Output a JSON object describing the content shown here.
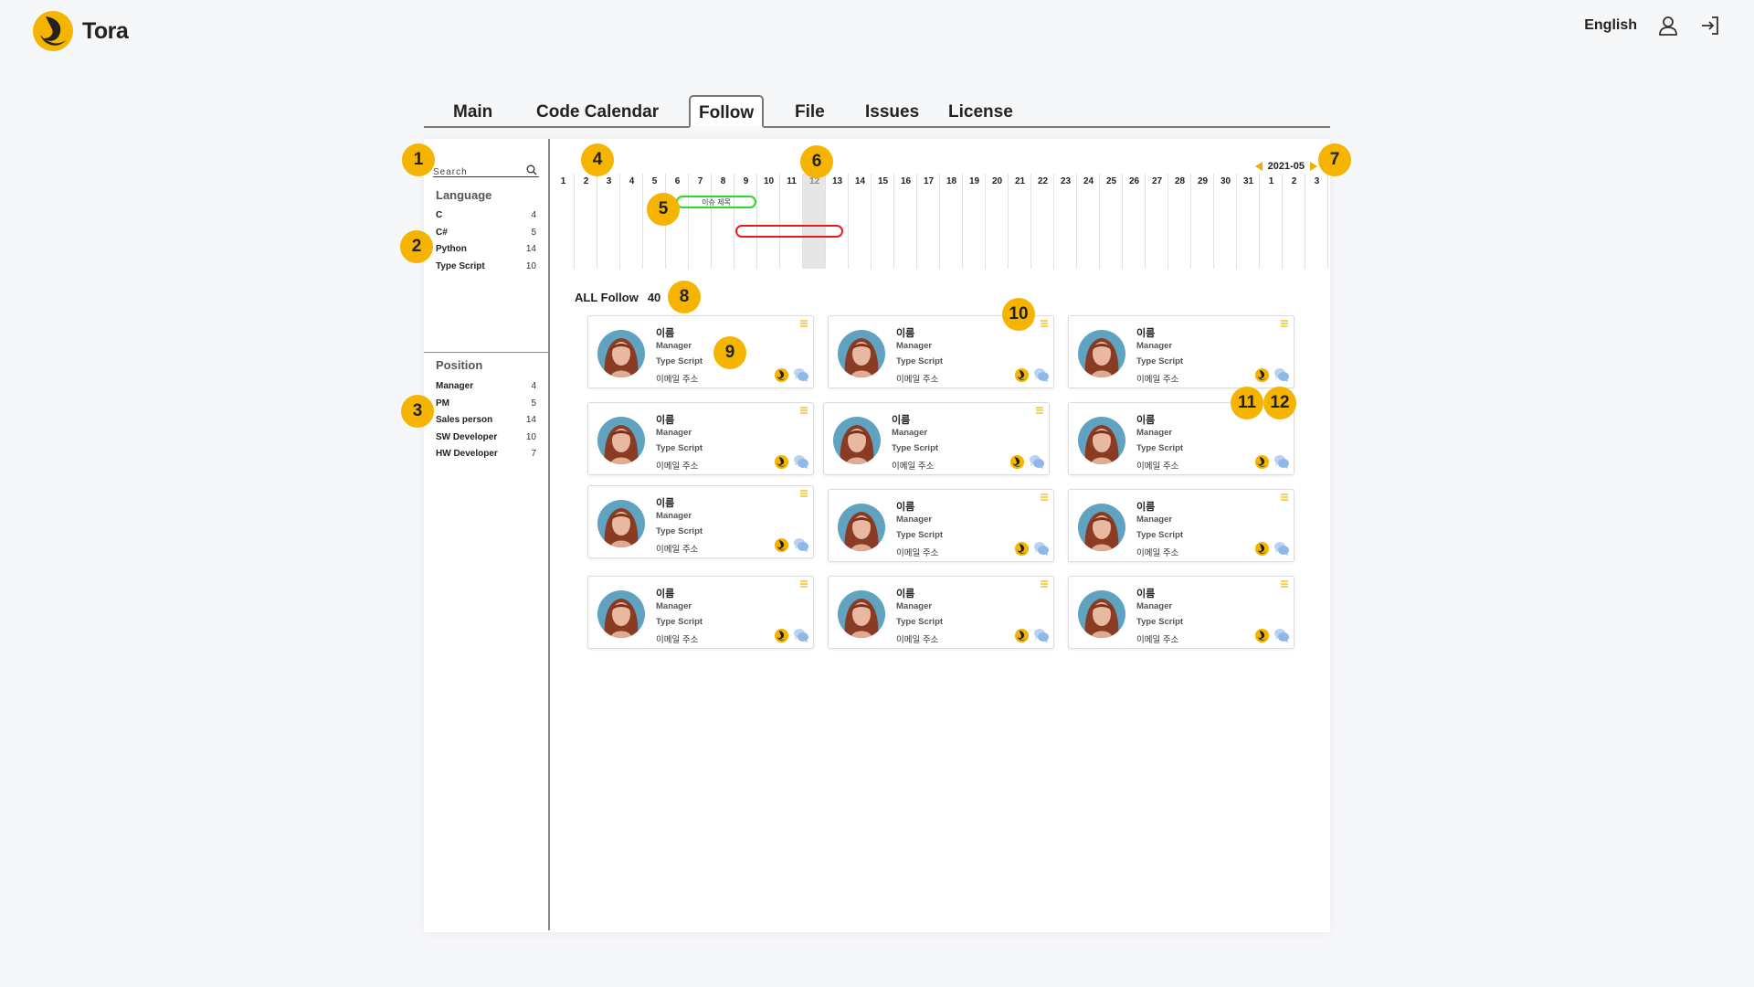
{
  "brand": {
    "name": "Tora",
    "accent": "#f5b400"
  },
  "header": {
    "language": "English"
  },
  "tabs": [
    {
      "label": "Main",
      "active": false
    },
    {
      "label": "Code Calendar",
      "active": false
    },
    {
      "label": "Follow",
      "active": true
    },
    {
      "label": "File",
      "active": false
    },
    {
      "label": "Issues",
      "active": false
    },
    {
      "label": "License",
      "active": false
    }
  ],
  "sidebar": {
    "search_placeholder": "Search",
    "language_title": "Language",
    "languages": [
      {
        "name": "C",
        "count": "4"
      },
      {
        "name": "C#",
        "count": "5"
      },
      {
        "name": "Python",
        "count": "14"
      },
      {
        "name": "Type Script",
        "count": "10"
      }
    ],
    "position_title": "Position",
    "positions": [
      {
        "name": "Manager",
        "count": "4"
      },
      {
        "name": "PM",
        "count": "5"
      },
      {
        "name": "Sales person",
        "count": "14"
      },
      {
        "name": "SW Developer",
        "count": "10"
      },
      {
        "name": "HW Developer",
        "count": "7"
      }
    ]
  },
  "timeline": {
    "month": "2021-05",
    "days": [
      "1",
      "2",
      "3",
      "4",
      "5",
      "6",
      "7",
      "8",
      "9",
      "10",
      "11",
      "12",
      "13",
      "14",
      "15",
      "16",
      "17",
      "18",
      "19",
      "20",
      "21",
      "22",
      "23",
      "24",
      "25",
      "26",
      "27",
      "28",
      "29",
      "30",
      "31",
      "1",
      "2",
      "3"
    ],
    "today": "12",
    "issues": [
      {
        "title": "이슈 제목",
        "color": "green"
      },
      {
        "title": "",
        "color": "red"
      }
    ]
  },
  "follow": {
    "label": "ALL Follow",
    "count": "40",
    "card": {
      "name": "이름",
      "position": "Manager",
      "language": "Type Script",
      "email": "이메일 주소"
    }
  },
  "markers": [
    "1",
    "2",
    "3",
    "4",
    "5",
    "6",
    "7",
    "8",
    "9",
    "10",
    "11",
    "12"
  ]
}
